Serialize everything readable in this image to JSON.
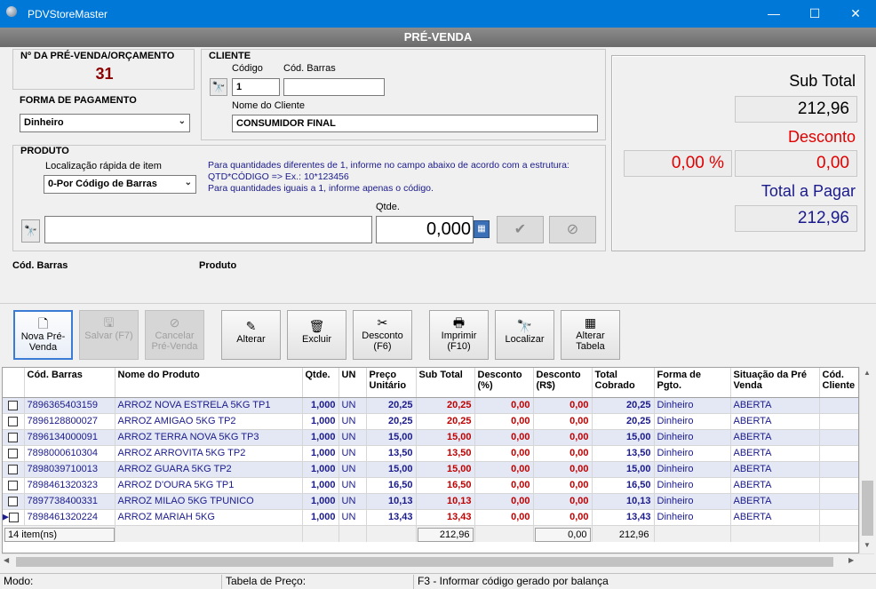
{
  "window": {
    "title": "PDVStoreMaster",
    "minimize": "—",
    "maximize": "☐",
    "close": "✕"
  },
  "header": {
    "title": "PRÉ-VENDA"
  },
  "prevenda": {
    "label": "Nº DA PRÉ-VENDA/ORÇAMENTO",
    "number": "31"
  },
  "payment": {
    "label": "FORMA DE PAGAMENTO",
    "value": "Dinheiro"
  },
  "client": {
    "label": "CLIENTE",
    "code_label": "Código",
    "code_value": "1",
    "barcode_label": "Cód. Barras",
    "barcode_value": "",
    "name_label": "Nome do Cliente",
    "name_value": "CONSUMIDOR FINAL"
  },
  "product": {
    "label": "PRODUTO",
    "quick_label": "Localização rápida de item",
    "quick_value": "0-Por Código de Barras",
    "help_line1": "Para quantidades diferentes de 1, informe no campo abaixo de acordo com a estrutura:",
    "help_line2": "QTD*CÓDIGO => Ex.: 10*123456",
    "help_line3": "Para quantidades iguais a 1, informe apenas o código.",
    "qty_label": "Qtde.",
    "qty_value": "0,000",
    "search_value": "",
    "barcode_caption": "Cód. Barras",
    "product_caption": "Produto"
  },
  "totals": {
    "subtotal_label": "Sub Total",
    "subtotal_value": "212,96",
    "discount_label": "Desconto",
    "discount_pct": "0,00 %",
    "discount_value": "0,00",
    "total_label": "Total a Pagar",
    "total_value": "212,96",
    "colors": {
      "discount": "#e00000",
      "total": "#1a1a8c"
    }
  },
  "toolbar": {
    "nova": "Nova Pré-Venda",
    "salvar": "Salvar (F7)",
    "cancelar": "Cancelar Pré-Venda",
    "alterar": "Alterar",
    "excluir": "Excluir",
    "desconto": "Desconto (F6)",
    "imprimir": "Imprimir (F10)",
    "localizar": "Localizar",
    "alterar_tabela": "Alterar Tabela"
  },
  "grid": {
    "columns": [
      "Cód. Barras",
      "Nome do Produto",
      "Qtde.",
      "UN",
      "Preço Unitário",
      "Sub Total",
      "Desconto (%)",
      "Desconto (R$)",
      "Total Cobrado",
      "Forma de Pgto.",
      "Situação da Pré Venda",
      "Cód. Cliente"
    ],
    "rows": [
      [
        "7896365403159",
        "ARROZ NOVA ESTRELA 5KG TP1",
        "1,000",
        "UN",
        "20,25",
        "20,25",
        "0,00",
        "0,00",
        "20,25",
        "Dinheiro",
        "ABERTA",
        ""
      ],
      [
        "7896128800027",
        "ARROZ AMIGAO 5KG TP2",
        "1,000",
        "UN",
        "20,25",
        "20,25",
        "0,00",
        "0,00",
        "20,25",
        "Dinheiro",
        "ABERTA",
        ""
      ],
      [
        "7896134000091",
        "ARROZ TERRA NOVA 5KG TP3",
        "1,000",
        "UN",
        "15,00",
        "15,00",
        "0,00",
        "0,00",
        "15,00",
        "Dinheiro",
        "ABERTA",
        ""
      ],
      [
        "7898000610304",
        "ARROZ ARROVITA 5KG TP2",
        "1,000",
        "UN",
        "13,50",
        "13,50",
        "0,00",
        "0,00",
        "13,50",
        "Dinheiro",
        "ABERTA",
        ""
      ],
      [
        "7898039710013",
        "ARROZ GUARA 5KG TP2",
        "1,000",
        "UN",
        "15,00",
        "15,00",
        "0,00",
        "0,00",
        "15,00",
        "Dinheiro",
        "ABERTA",
        ""
      ],
      [
        "7898461320323",
        "ARROZ D'OURA 5KG TP1",
        "1,000",
        "UN",
        "16,50",
        "16,50",
        "0,00",
        "0,00",
        "16,50",
        "Dinheiro",
        "ABERTA",
        ""
      ],
      [
        "7897738400331",
        "ARROZ MILAO 5KG TPUNICO",
        "1,000",
        "UN",
        "10,13",
        "10,13",
        "0,00",
        "0,00",
        "10,13",
        "Dinheiro",
        "ABERTA",
        ""
      ],
      [
        "7898461320224",
        "ARROZ MARIAH 5KG",
        "1,000",
        "UN",
        "13,43",
        "13,43",
        "0,00",
        "0,00",
        "13,43",
        "Dinheiro",
        "ABERTA",
        ""
      ]
    ],
    "footer": {
      "count": "14 item(ns)",
      "subtotal": "212,96",
      "discount": "0,00",
      "total": "212,96"
    }
  },
  "status": {
    "mode": "Modo:",
    "price_table": "Tabela de Preço:",
    "hint": "F3 - Informar código gerado por balança"
  }
}
